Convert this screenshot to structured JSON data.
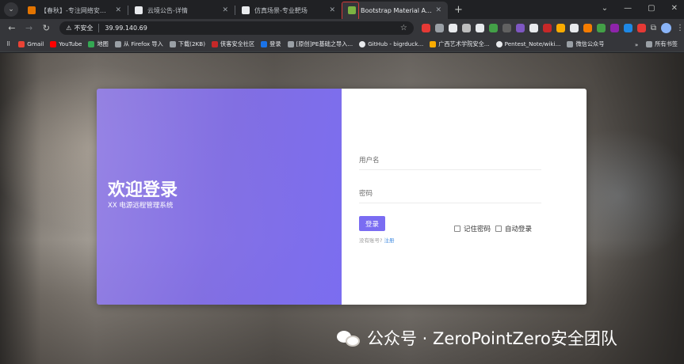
{
  "browser": {
    "tabs": [
      {
        "label": "【春秋】-专注网络安全_信息安全",
        "favicon_color": "#e37400",
        "active": false
      },
      {
        "label": "云境公告-详情",
        "favicon_color": "#e8eaed",
        "active": false
      },
      {
        "label": "仿真场景-专业靶场",
        "favicon_color": "#e8eaed",
        "active": false
      },
      {
        "label": "Bootstrap Material Admin",
        "favicon_color": "#7cb342",
        "active": true
      }
    ],
    "new_tab_glyph": "+",
    "menu_glyph": "⌄",
    "window_controls": [
      "⌄",
      "—",
      "▢",
      "✕"
    ],
    "nav": {
      "back": "←",
      "forward": "→",
      "reload": "↻"
    },
    "omnibox": {
      "security_label": "不安全",
      "url": "39.99.140.69"
    },
    "bookmarks": [
      {
        "label": "Gmail",
        "color": "#ea4335"
      },
      {
        "label": "YouTube",
        "color": "#ff0000"
      },
      {
        "label": "地图",
        "color": "#34a853"
      },
      {
        "label": "从 Firefox 导入",
        "color": "#9aa0a6"
      },
      {
        "label": "下载(2KB)",
        "color": "#9aa0a6"
      },
      {
        "label": "侠客安全社区",
        "color": "#c62828"
      },
      {
        "label": "登录",
        "color": "#1a73e8"
      },
      {
        "label": "[原创]PE基础之导入...",
        "color": "#9aa0a6"
      },
      {
        "label": "GitHub - bigrduck...",
        "color": "#e8eaed"
      },
      {
        "label": "广西艺术学院安全...",
        "color": "#f9ab00"
      },
      {
        "label": "Pentest_Note/wiki...",
        "color": "#e8eaed"
      },
      {
        "label": "微信公众号",
        "color": "#9aa0a6"
      }
    ],
    "bookmarks_overflow": "»",
    "all_bookmarks": "所有书签"
  },
  "login": {
    "welcome_title": "欢迎登录",
    "welcome_subtitle": "XX 电源远程管理系统",
    "username_placeholder": "用户名",
    "password_placeholder": "密码",
    "login_button": "登录",
    "remember_password": "记住密码",
    "auto_login": "自动登录",
    "no_account_text": "没有账号?",
    "register_link": "注册"
  },
  "watermark": {
    "text": "公众号 · ZeroPointZero安全团队"
  },
  "colors": {
    "accent": "#7a6cf2",
    "panel_gradient_end": "#7b6df0",
    "link": "#4a90e2"
  }
}
